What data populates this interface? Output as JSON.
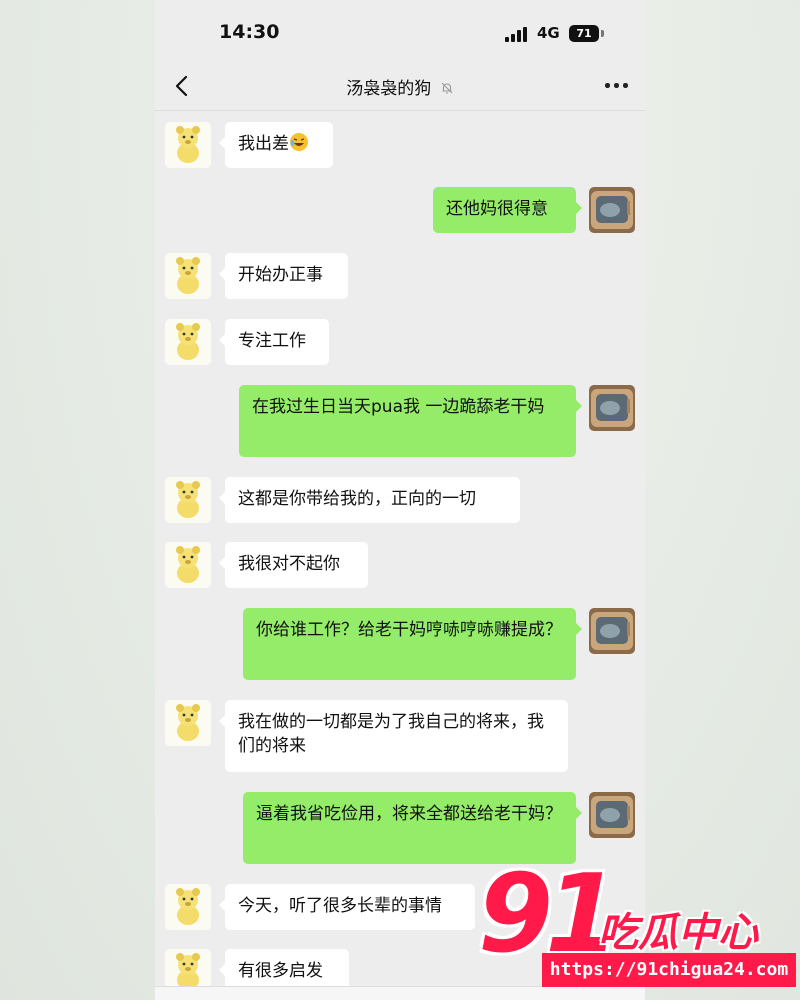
{
  "status_bar": {
    "time": "14:30",
    "network": "4G",
    "battery": "71"
  },
  "header": {
    "title": "汤袅袅的狗"
  },
  "messages": [
    {
      "side": "left",
      "text": "我出差"
    },
    {
      "side": "right",
      "text": "还他妈很得意"
    },
    {
      "side": "left",
      "text": "开始办正事"
    },
    {
      "side": "left",
      "text": "专注工作"
    },
    {
      "side": "right",
      "text": "在我过生日当天pua我 一边跪舔老干妈"
    },
    {
      "side": "left",
      "text": "这都是你带给我的，正向的一切"
    },
    {
      "side": "left",
      "text": "我很对不起你"
    },
    {
      "side": "right",
      "text": "你给谁工作？给老干妈哼哧哼哧赚提成？"
    },
    {
      "side": "left",
      "text": "我在做的一切都是为了我自己的将来，我们的将来"
    },
    {
      "side": "right",
      "text": "逼着我省吃俭用，将来全都送给老干妈？"
    },
    {
      "side": "left",
      "text": "今天，听了很多长辈的事情"
    },
    {
      "side": "left",
      "text": "有很多启发"
    }
  ],
  "watermark": {
    "number": "91",
    "brand": "吃瓜中心",
    "url": "https://91chigua24.com"
  },
  "colors": {
    "bubble_self": "#95ec69",
    "bubble_other": "#ffffff",
    "chat_bg": "#ededed",
    "watermark": "#ff1a4a"
  }
}
